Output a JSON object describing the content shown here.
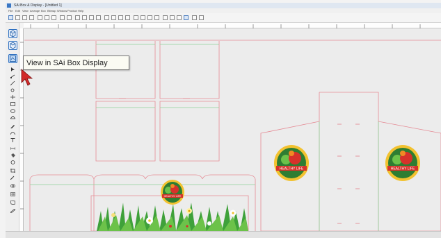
{
  "window": {
    "title": "SAi Box & Display - [Untitled 1]"
  },
  "menu": {
    "items": [
      "File",
      "Edit",
      "View",
      "Arrange",
      "Box",
      "Bitmap",
      "Window",
      "Product",
      "Help"
    ]
  },
  "tooltip": {
    "text": "View in SAi Box  Display"
  },
  "artwork": {
    "brand_label": "HEALTHY LIFE"
  },
  "colors": {
    "accent": "#3a77c4",
    "cut_line": "#e58a94",
    "fold_line": "#8fd39a",
    "grass": "#3fa13a",
    "logo_red": "#d6322b",
    "logo_green": "#2e7d32",
    "logo_gold": "#f2c230"
  },
  "icons": {
    "left_toolbar": [
      "view-3d-icon",
      "view-box-icon",
      "view-in-box-display-icon"
    ],
    "cursor": "arrow-cursor-icon"
  }
}
